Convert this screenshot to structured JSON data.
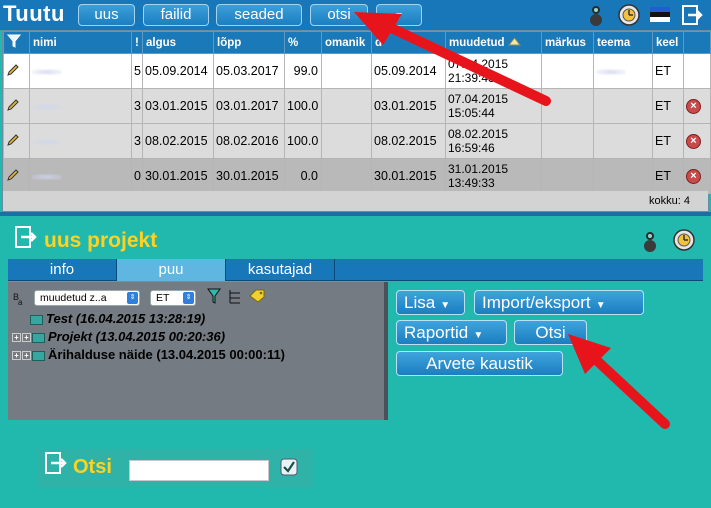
{
  "app": {
    "title": "Tuutu"
  },
  "toolbar": {
    "buttons": [
      {
        "label": "uus"
      },
      {
        "label": "failid"
      },
      {
        "label": "seaded"
      },
      {
        "label": "otsi"
      }
    ],
    "dropdown_caret": "▼",
    "icons": [
      "user-icon",
      "clock-icon",
      "flag-icon",
      "logout-icon"
    ]
  },
  "grid": {
    "columns": [
      "nimi",
      "!",
      "algus",
      "lõpp",
      "%",
      "omanik",
      "d",
      "muudetud",
      "märkus",
      "teema",
      "keel"
    ],
    "rows": [
      {
        "prio": "5",
        "start": "05.09.2014",
        "end": "05.03.2017",
        "pct": "99.0",
        "created": "05.09.2014",
        "modified_date": "07.04.2015",
        "modified_time": "21:39:43",
        "lang": "ET",
        "deletable": false
      },
      {
        "prio": "3",
        "start": "03.01.2015",
        "end": "03.01.2017",
        "pct": "100.0",
        "created": "03.01.2015",
        "modified_date": "07.04.2015",
        "modified_time": "15:05:44",
        "lang": "ET",
        "deletable": true
      },
      {
        "prio": "3",
        "start": "08.02.2015",
        "end": "08.02.2016",
        "pct": "100.0",
        "created": "08.02.2015",
        "modified_date": "08.02.2015",
        "modified_time": "16:59:46",
        "lang": "ET",
        "deletable": true
      },
      {
        "prio": "0",
        "start": "30.01.2015",
        "end": "30.01.2015",
        "pct": "0.0",
        "created": "30.01.2015",
        "modified_date": "31.01.2015",
        "modified_time": "13:49:33",
        "lang": "ET",
        "deletable": true
      }
    ],
    "footer": "kokku: 4"
  },
  "project": {
    "title": "uus projekt",
    "tabs": [
      {
        "label": "info",
        "active": false
      },
      {
        "label": "puu",
        "active": true
      },
      {
        "label": "kasutajad",
        "active": false
      }
    ],
    "tree_controls": {
      "sort_value": "muudetud z..a",
      "lang_value": "ET"
    },
    "tree_items": [
      {
        "label": "Test (16.04.2015 13:28:19)",
        "italic": true,
        "expandable": false
      },
      {
        "label": "Projekt (13.04.2015 00:20:36)",
        "italic": true,
        "expandable": true
      },
      {
        "label": "Ärihalduse näide (13.04.2015 00:00:11)",
        "italic": false,
        "expandable": true
      }
    ],
    "actions": {
      "lisa": "Lisa",
      "import_export": "Import/eksport",
      "raportid": "Raportid",
      "otsi": "Otsi",
      "arvete_kaustik": "Arvete kaustik"
    }
  },
  "search": {
    "label": "Otsi",
    "value": ""
  },
  "colors": {
    "background": "#21b9ad",
    "header_blue": "#1877b8",
    "accent_yellow": "#ffd21f",
    "annotation_red": "#e8141b"
  }
}
